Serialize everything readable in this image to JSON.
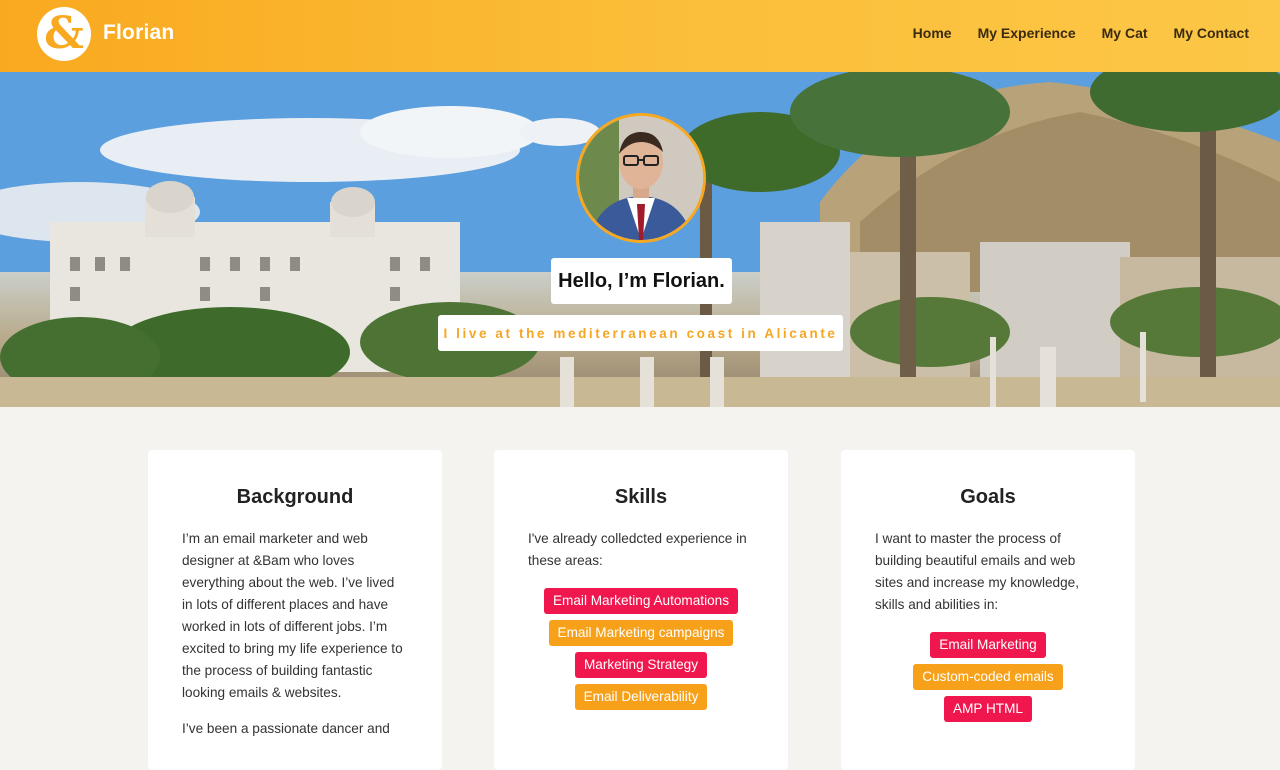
{
  "header": {
    "logo_glyph": "&",
    "brand": "Florian",
    "nav": [
      {
        "label": "Home"
      },
      {
        "label": "My Experience"
      },
      {
        "label": "My Cat"
      },
      {
        "label": "My Contact"
      }
    ]
  },
  "hero": {
    "greeting": "Hello, I’m Florian.",
    "subtitle": "I live at the mediterranean coast in Alicante"
  },
  "cards": [
    {
      "title": "Background",
      "intro": "I’m an email marketer and web designer at &Bam who loves everything about the web. I’ve lived in lots of different places and have worked in lots of different jobs. I’m excited to bring my life experience to the process of building fantastic looking emails & websites.",
      "para2": "I’ve been a passionate dancer and"
    },
    {
      "title": "Skills",
      "intro": "I've already colledcted experience in these areas:",
      "tags": [
        {
          "label": "Email Marketing Automations",
          "color": "#f0174f"
        },
        {
          "label": "Email Marketing campaigns",
          "color": "#f7a11b"
        },
        {
          "label": "Marketing Strategy",
          "color": "#f0174f"
        },
        {
          "label": "Email Deliverability",
          "color": "#f7a11b"
        }
      ]
    },
    {
      "title": "Goals",
      "intro": "I want to master the process of building beautiful emails and web sites and increase my knowledge, skills and abilities in:",
      "tags": [
        {
          "label": "Email Marketing",
          "color": "#f0174f"
        },
        {
          "label": "Custom-coded emails",
          "color": "#f7a11b"
        },
        {
          "label": "AMP HTML",
          "color": "#f0174f"
        }
      ]
    }
  ],
  "colors": {
    "accent": "#f9a91f",
    "tag_red": "#f0174f",
    "tag_orange": "#f7a11b"
  }
}
